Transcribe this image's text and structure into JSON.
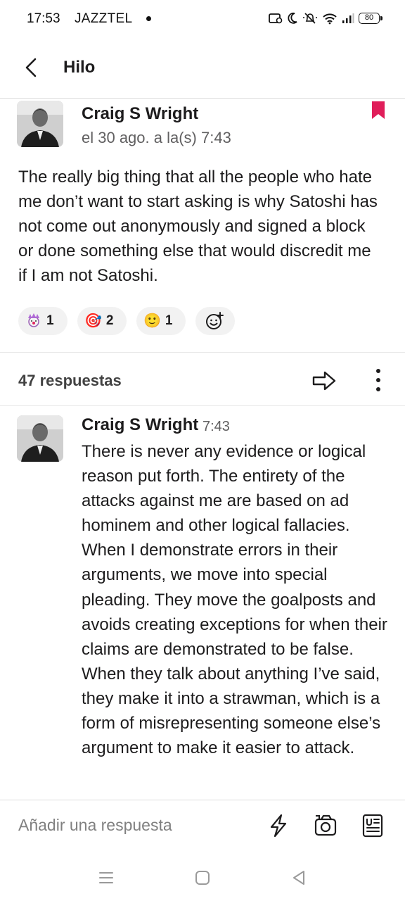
{
  "status_bar": {
    "time": "17:53",
    "carrier": "JAZZTEL",
    "battery": "80"
  },
  "header": {
    "title": "Hilo"
  },
  "parent_message": {
    "author": "Craig S Wright",
    "timestamp": "el 30 ago. a la(s) 7:43",
    "text": "The really big thing that all the people who hate me don’t want to start asking is why Satoshi has not come out anonymously and signed a block or done something else that would discredit me if I am not Satoshi.",
    "reactions": [
      {
        "emoji": "clown-emoji",
        "count": "1"
      },
      {
        "emoji": "🎯",
        "count": "2"
      },
      {
        "emoji": "🙂",
        "count": "1"
      }
    ]
  },
  "thread": {
    "replies_label": "47 respuestas"
  },
  "reply": {
    "author": "Craig S Wright",
    "time": "7:43",
    "text": "There is never any evidence or logical reason put forth. The entirety of the attacks against me are based on ad hominem and other logical fallacies. When I demonstrate errors in their arguments, we move into special pleading. They move the goalposts and avoids creating exceptions for when their claims are demonstrated to be false. When they talk about anything I’ve said, they make it into a strawman, which is a form of misrepresenting someone else’s argument to make it easier to attack."
  },
  "composer": {
    "placeholder": "Añadir una respuesta"
  },
  "icons": {
    "bookmark": "bookmark-icon",
    "share": "share-arrow-icon",
    "more": "more-vertical-icon",
    "shortcut": "lightning-icon",
    "camera": "camera-icon",
    "format": "text-format-icon"
  },
  "colors": {
    "bookmark": "#e01e5a",
    "text": "#1d1c1d",
    "muted": "#616061",
    "reaction_bg": "#f2f2f2"
  }
}
